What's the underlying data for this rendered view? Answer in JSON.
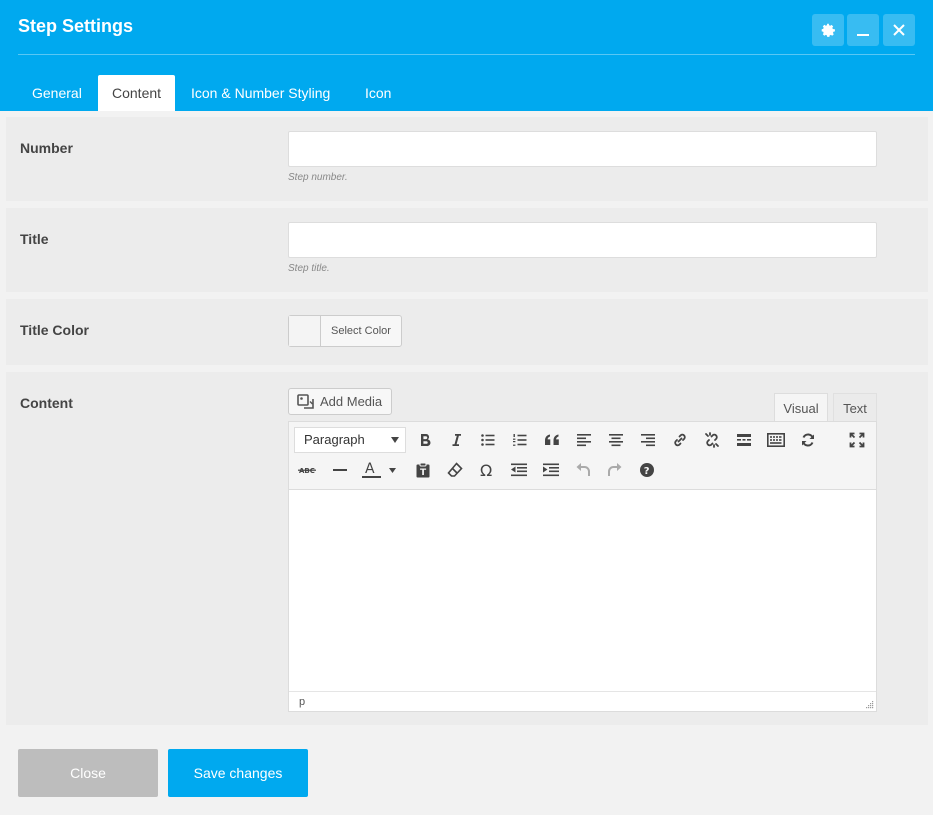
{
  "dialog": {
    "title": "Step Settings",
    "accent_color": "#00a9ef"
  },
  "header_buttons": {
    "settings_icon": "gear-icon",
    "minimize_icon": "minimize-icon",
    "close_icon": "close-icon"
  },
  "tabs": [
    {
      "label": "General",
      "active": false
    },
    {
      "label": "Content",
      "active": true
    },
    {
      "label": "Icon & Number Styling",
      "active": false
    },
    {
      "label": "Icon",
      "active": false
    }
  ],
  "fields": {
    "number": {
      "label": "Number",
      "value": "",
      "hint": "Step number."
    },
    "title": {
      "label": "Title",
      "value": "",
      "hint": "Step title."
    },
    "title_color": {
      "label": "Title Color",
      "button": "Select Color"
    },
    "content": {
      "label": "Content",
      "add_media": "Add Media",
      "mode_tabs": {
        "visual": "Visual",
        "text": "Text"
      },
      "format_select": "Paragraph",
      "status_path": "p",
      "toolbar_row1": [
        "bold-icon",
        "italic-icon",
        "bullet-list-icon",
        "numbered-list-icon",
        "blockquote-icon",
        "align-left-icon",
        "align-center-icon",
        "align-right-icon",
        "link-icon",
        "unlink-icon",
        "read-more-icon",
        "toolbar-toggle-icon",
        "refresh-icon",
        "fullscreen-icon"
      ],
      "toolbar_row2": [
        "strikethrough-icon",
        "horizontal-rule-icon",
        "text-color-icon",
        "paste-text-icon",
        "clear-formatting-icon",
        "special-character-icon",
        "outdent-icon",
        "indent-icon",
        "undo-icon",
        "redo-icon",
        "help-icon"
      ]
    }
  },
  "footer": {
    "close_label": "Close",
    "save_label": "Save changes"
  }
}
